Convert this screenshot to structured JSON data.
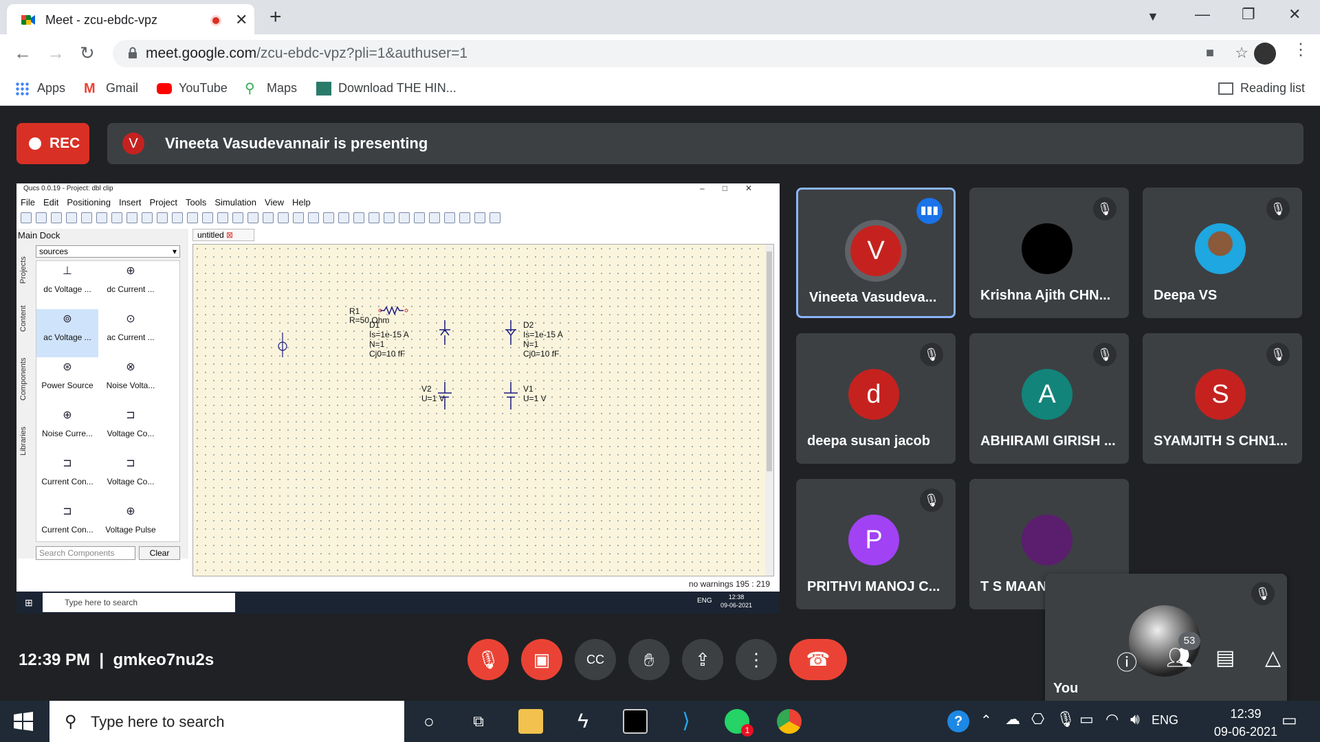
{
  "browser": {
    "tab_title": "Meet - zcu-ebdc-vpz",
    "url_host": "meet.google.com",
    "url_path": "/zcu-ebdc-vpz?pli=1&authuser=1",
    "bookmarks": [
      "Apps",
      "Gmail",
      "YouTube",
      "Maps",
      "Download THE HIN..."
    ],
    "reading_list": "Reading list"
  },
  "meet": {
    "rec_label": "REC",
    "presenter_initial": "V",
    "presenting_text": "Vineeta Vasudevannair is presenting",
    "clock": "12:39 PM",
    "separator": "|",
    "meeting_code": "gmkeo7nu2s",
    "participant_count": "53"
  },
  "qucs": {
    "title": "Qucs 0.0.19 - Project: dbl clip",
    "menu": [
      "File",
      "Edit",
      "Positioning",
      "Insert",
      "Project",
      "Tools",
      "Simulation",
      "View",
      "Help"
    ],
    "dock_title": "Main Dock",
    "dock_category": "sources",
    "dock_tabs": [
      "Projects",
      "Content",
      "Components",
      "Libraries"
    ],
    "components": [
      "dc Voltage ...",
      "dc Current ...",
      "ac Voltage ...",
      "ac Current ...",
      "Power Source",
      "Noise Volta...",
      "Noise Curre...",
      "Voltage Co...",
      "Current Con...",
      "Voltage Co...",
      "Current Con...",
      "Voltage Pulse"
    ],
    "search_placeholder": "Search Components",
    "clear_label": "Clear",
    "doc_tab": "untitled",
    "status": "no warnings 195 : 219",
    "labels": {
      "r1": "R1",
      "r1v": "R=50 Ohm",
      "d1": "D1",
      "d1is": "Is=1e-15 A",
      "d1n": "N=1",
      "d1c": "Cj0=10 fF",
      "d2": "D2",
      "d2is": "Is=1e-15 A",
      "d2n": "N=1",
      "d2c": "Cj0=10 fF",
      "v2": "V2",
      "v2u": "U=1 V",
      "v1": "V1",
      "v1u": "U=1 V"
    },
    "inner_search": "Type here to search",
    "inner_lang": "ENG",
    "inner_time": "12:38",
    "inner_date": "09-06-2021"
  },
  "tiles": [
    {
      "name": "Vineeta Vasudeva...",
      "initial": "V",
      "color": "#c5221f"
    },
    {
      "name": "Krishna Ajith CHN...",
      "initial": "",
      "color": "#000000"
    },
    {
      "name": "Deepa VS",
      "initial": "",
      "color": "#1ea7e0"
    },
    {
      "name": "deepa susan jacob",
      "initial": "d",
      "color": "#c5221f"
    },
    {
      "name": "ABHIRAMI GIRISH ...",
      "initial": "A",
      "color": "#12847a"
    },
    {
      "name": "SYAMJITH S CHN1...",
      "initial": "S",
      "color": "#c5221f"
    },
    {
      "name": "PRITHVI MANOJ C...",
      "initial": "P",
      "color": "#a142f4"
    },
    {
      "name": "T S MAAN",
      "initial": "",
      "color": "#5b1e6e"
    }
  ],
  "you_label": "You",
  "taskbar": {
    "search_placeholder": "Type here to search",
    "lang": "ENG",
    "time": "12:39",
    "date": "09-06-2021",
    "whatsapp_badge": "1"
  }
}
